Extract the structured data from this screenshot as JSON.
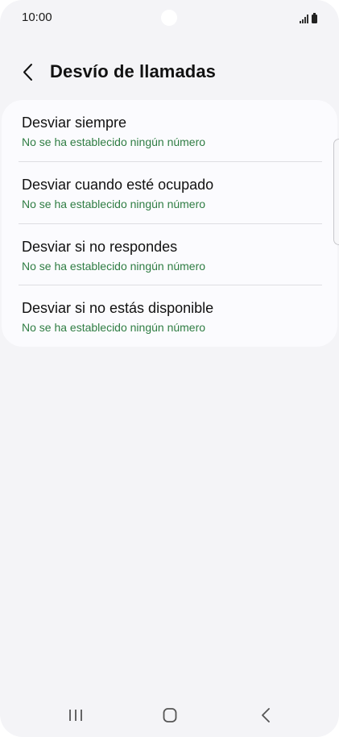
{
  "status_bar": {
    "time": "10:00"
  },
  "header": {
    "title": "Desvío de llamadas"
  },
  "items": [
    {
      "title": "Desviar siempre",
      "subtitle": "No se ha establecido ningún número"
    },
    {
      "title": "Desviar cuando esté ocupado",
      "subtitle": "No se ha establecido ningún número"
    },
    {
      "title": "Desviar si no respondes",
      "subtitle": "No se ha establecido ningún número"
    },
    {
      "title": "Desviar si no estás disponible",
      "subtitle": "No se ha establecido ningún número"
    }
  ],
  "colors": {
    "subtitle": "#2f7d43",
    "background": "#f4f4f7",
    "card": "#fbfbfe"
  },
  "icons": {
    "back": "chevron-left-icon",
    "signal": "signal-icon",
    "battery": "battery-icon",
    "nav_recents": "recents-icon",
    "nav_home": "home-icon",
    "nav_back": "back-icon"
  }
}
